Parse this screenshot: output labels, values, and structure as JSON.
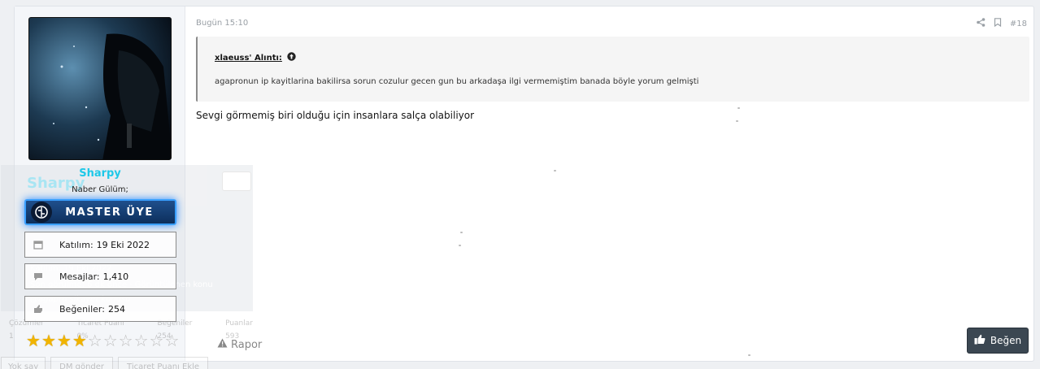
{
  "post": {
    "time": "Bugün 15:10",
    "number": "#18",
    "quote": {
      "title": "xlaeuss' Alıntı:",
      "body": "agapronun ip kayitlarina bakilirsa sorun cozulur gecen gun bu arkadaşa ilgi vermemiştim banada böyle yorum gelmişti"
    },
    "text": "Sevgi görmemiş biri olduğu için insanlara salça olabiliyor",
    "like_label": "Beğen",
    "report_label": "Rapor"
  },
  "user": {
    "name": "Sharpy",
    "title": "Naber Gülüm;",
    "banner": "MASTER ÜYE",
    "stats": [
      {
        "label": "Katılım:",
        "value": "19 Eki 2022"
      },
      {
        "label": "Mesajlar:",
        "value": "1,410"
      },
      {
        "label": "Beğeniler:",
        "value": "254"
      }
    ],
    "rating": {
      "filled": 4,
      "total": 10
    }
  },
  "ghost": {
    "name": "Sharpy",
    "joined": "Katılım: 19 Eki 2022",
    "last_seen": "Son görülme: 6 dk önce · Görüntülenen konu",
    "link": "@agapro şikayet konusu",
    "cols": [
      {
        "label": "Çözümler",
        "value": "1"
      },
      {
        "label": "Ticaret Puanı",
        "value": "0%"
      },
      {
        "label": "Beğeniler",
        "value": "254"
      },
      {
        "label": "Puanlar",
        "value": "593"
      }
    ],
    "buttons": [
      "Yok say",
      "DM gönder",
      "Ticaret Puanı Ekle"
    ]
  },
  "colors": {
    "username": "#1ec8e8",
    "banner": "#1f4f8c",
    "star": "#f1b400",
    "like": "#3b4752"
  }
}
